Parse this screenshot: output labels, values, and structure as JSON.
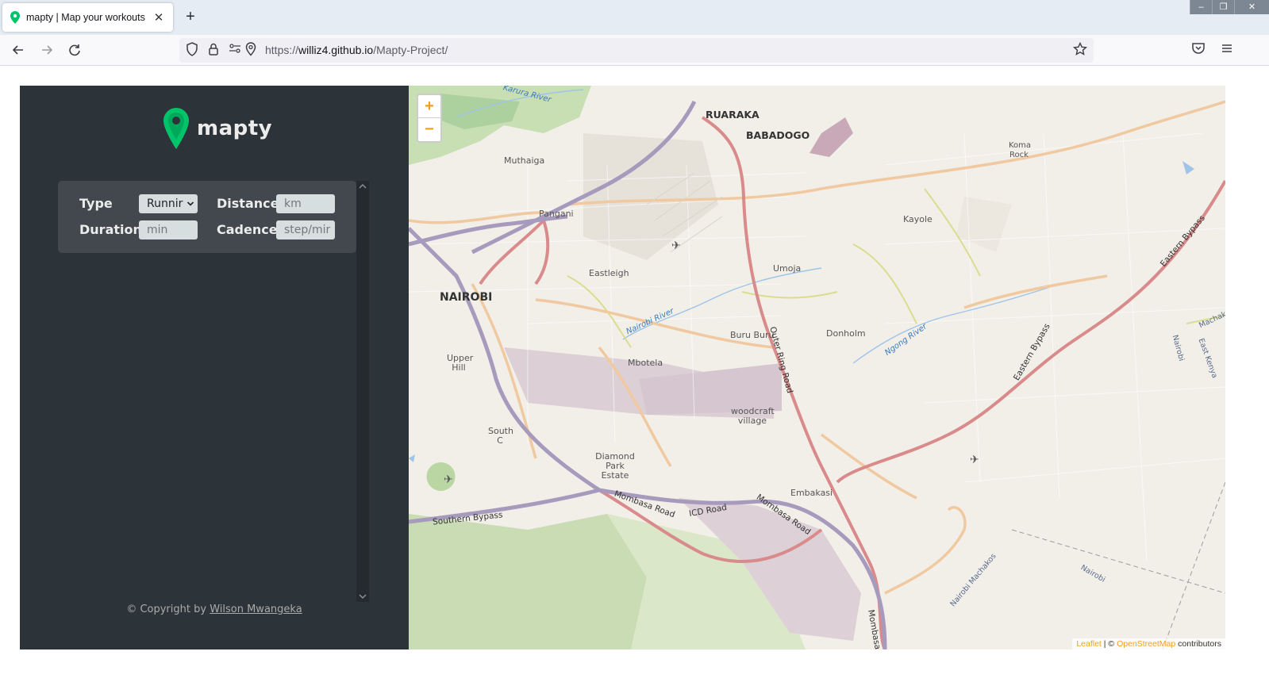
{
  "browser": {
    "tab_title": "mapty | Map your workouts",
    "tab_close": "✕",
    "new_tab": "+",
    "url_scheme": "https://",
    "url_host": "williz4.github.io",
    "url_path": "/Mapty-Project/",
    "window_controls": {
      "minimize": "–",
      "maximize": "❐",
      "close": "✕"
    }
  },
  "sidebar": {
    "logo_text": "mapty",
    "brand_color": "#00c46a",
    "form": {
      "type_label": "Type",
      "type_value": "Runnir",
      "distance_label": "Distance",
      "distance_placeholder": "km",
      "duration_label": "Duration",
      "duration_placeholder": "min",
      "cadence_label": "Cadence",
      "cadence_placeholder": "step/mir"
    },
    "copyright_prefix": "© Copyright by",
    "copyright_author": "Wilson Mwangeka"
  },
  "map": {
    "zoom_in": "+",
    "zoom_out": "−",
    "attribution_leaflet": "Leaflet",
    "attribution_sep": " | © ",
    "attribution_osm": "OpenStreetMap",
    "attribution_suffix": " contributors",
    "labels": {
      "ruaraka": "RUARAKA",
      "babadogo": "BABADOGO",
      "nairobi": "NAIROBI",
      "muthaiga": "Muthaiga",
      "pangani": "Pangani",
      "eastleigh": "Eastleigh",
      "umoja": "Umoja",
      "kayole": "Kayole",
      "koma_rock": "Koma Rock",
      "upper_hill": "Upper Hill",
      "mbotela": "Mbotela",
      "buru_buru": "Buru Buru",
      "donholm": "Donholm",
      "woodcraft_village": "woodcraft village",
      "south_c": "South C",
      "diamond_park_estate": "Diamond Park Estate",
      "embakasi": "Embakasi",
      "outer_ring_road": "Outer Ring Road",
      "eastern_bypass_1": "Eastern Bypass",
      "eastern_bypass_2": "Eastern Bypass",
      "mombasa_road_1": "Mombasa Road",
      "mombasa_road_2": "Mombasa Road",
      "mombasa_road_3": "Mombasa",
      "icd_road": "ICD Road",
      "southern_bypass": "Southern Bypass",
      "nairobi_river": "Nairobi River",
      "ngong_river": "Ngong River",
      "karura_river": "Karura River",
      "nairobi_machakos": "Nairobi Machakos",
      "machak": "Machak",
      "east_kenya": "East Kenya",
      "nairobi_small_1": "Nairobi",
      "nairobi_small_2": "Nairobi"
    }
  }
}
